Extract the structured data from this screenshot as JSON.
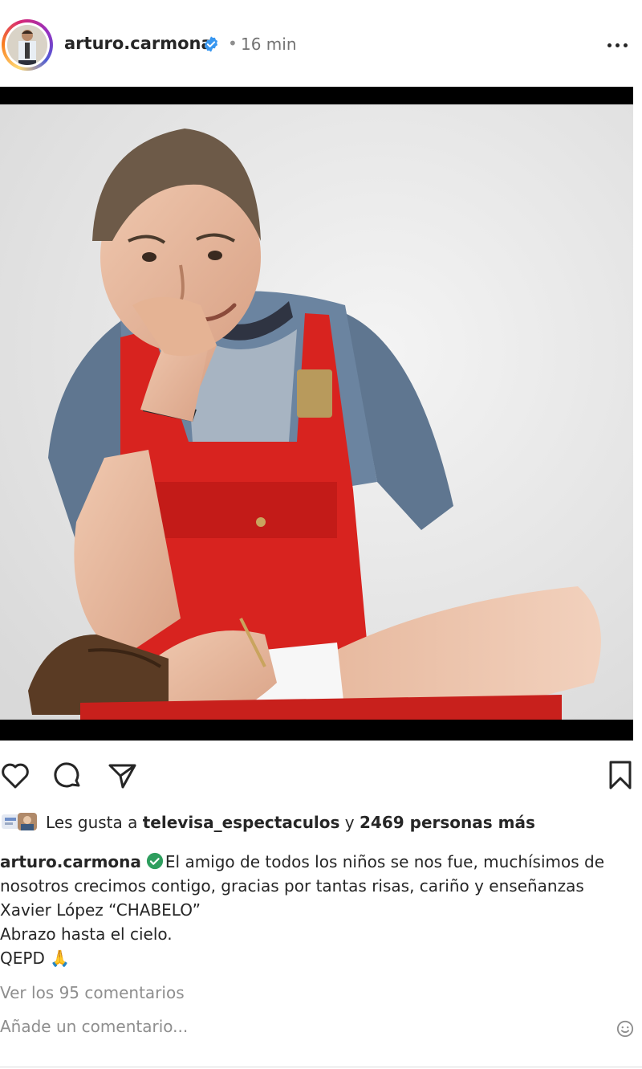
{
  "post": {
    "author": "arturo.carmona",
    "separator": "•",
    "time": "16 min",
    "verified": true
  },
  "likes": {
    "prefix": "Les gusta a",
    "liker": "televisa_espectaculos",
    "connector": "y",
    "others": "2469 personas más"
  },
  "caption": {
    "user": "arturo.carmona",
    "lines": [
      "El amigo de todos los niños se nos fue, muchísimos de",
      "nosotros crecimos contigo, gracias por tantas risas, cariño y enseñanzas",
      "Xavier López “CHABELO”",
      "Abrazo hasta el cielo.",
      "QEPD"
    ],
    "emoji": "🙏"
  },
  "comments": {
    "view_all": "Ver los 95 comentarios",
    "add_placeholder": "Añade un comentario..."
  },
  "icons": {
    "verified_badge": "verified-badge-icon",
    "more": "more-options-icon",
    "like": "heart-icon",
    "comment": "comment-bubble-icon",
    "share": "paper-plane-icon",
    "save": "bookmark-icon",
    "emoji": "smiley-icon"
  },
  "colors": {
    "verified_blue": "#3897f0",
    "caption_check_green": "#2e9e5e",
    "secondary_text": "#8e8e8e"
  }
}
